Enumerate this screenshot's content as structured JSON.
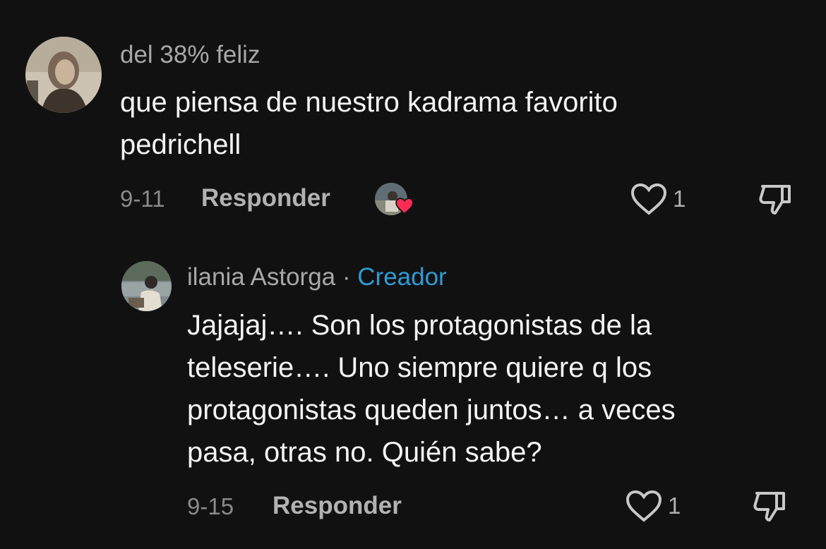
{
  "comment": {
    "username": "del 38% feliz",
    "text": "que piensa de nuestro kadrama favorito\npedrichell",
    "date": "9-11",
    "reply_label": "Responder",
    "like_count": "1"
  },
  "reply": {
    "username": "ilania Astorga",
    "separator": "·",
    "badge": "Creador",
    "text": "Jajajaj…. Son los protagonistas de la\nteleserie…. Uno siempre quiere q los\nprotagonistas queden juntos… a veces\npasa, otras no. Quién sabe?",
    "date": "9-15",
    "reply_label": "Responder",
    "like_count": "1"
  },
  "icons": {
    "like": "heart-outline-icon",
    "dislike": "thumbs-down-icon",
    "creator_liked": "heart-filled-icon"
  },
  "colors": {
    "background": "#111111",
    "creator_badge": "#2e9bd6",
    "liked_heart": "#fe2c55"
  }
}
